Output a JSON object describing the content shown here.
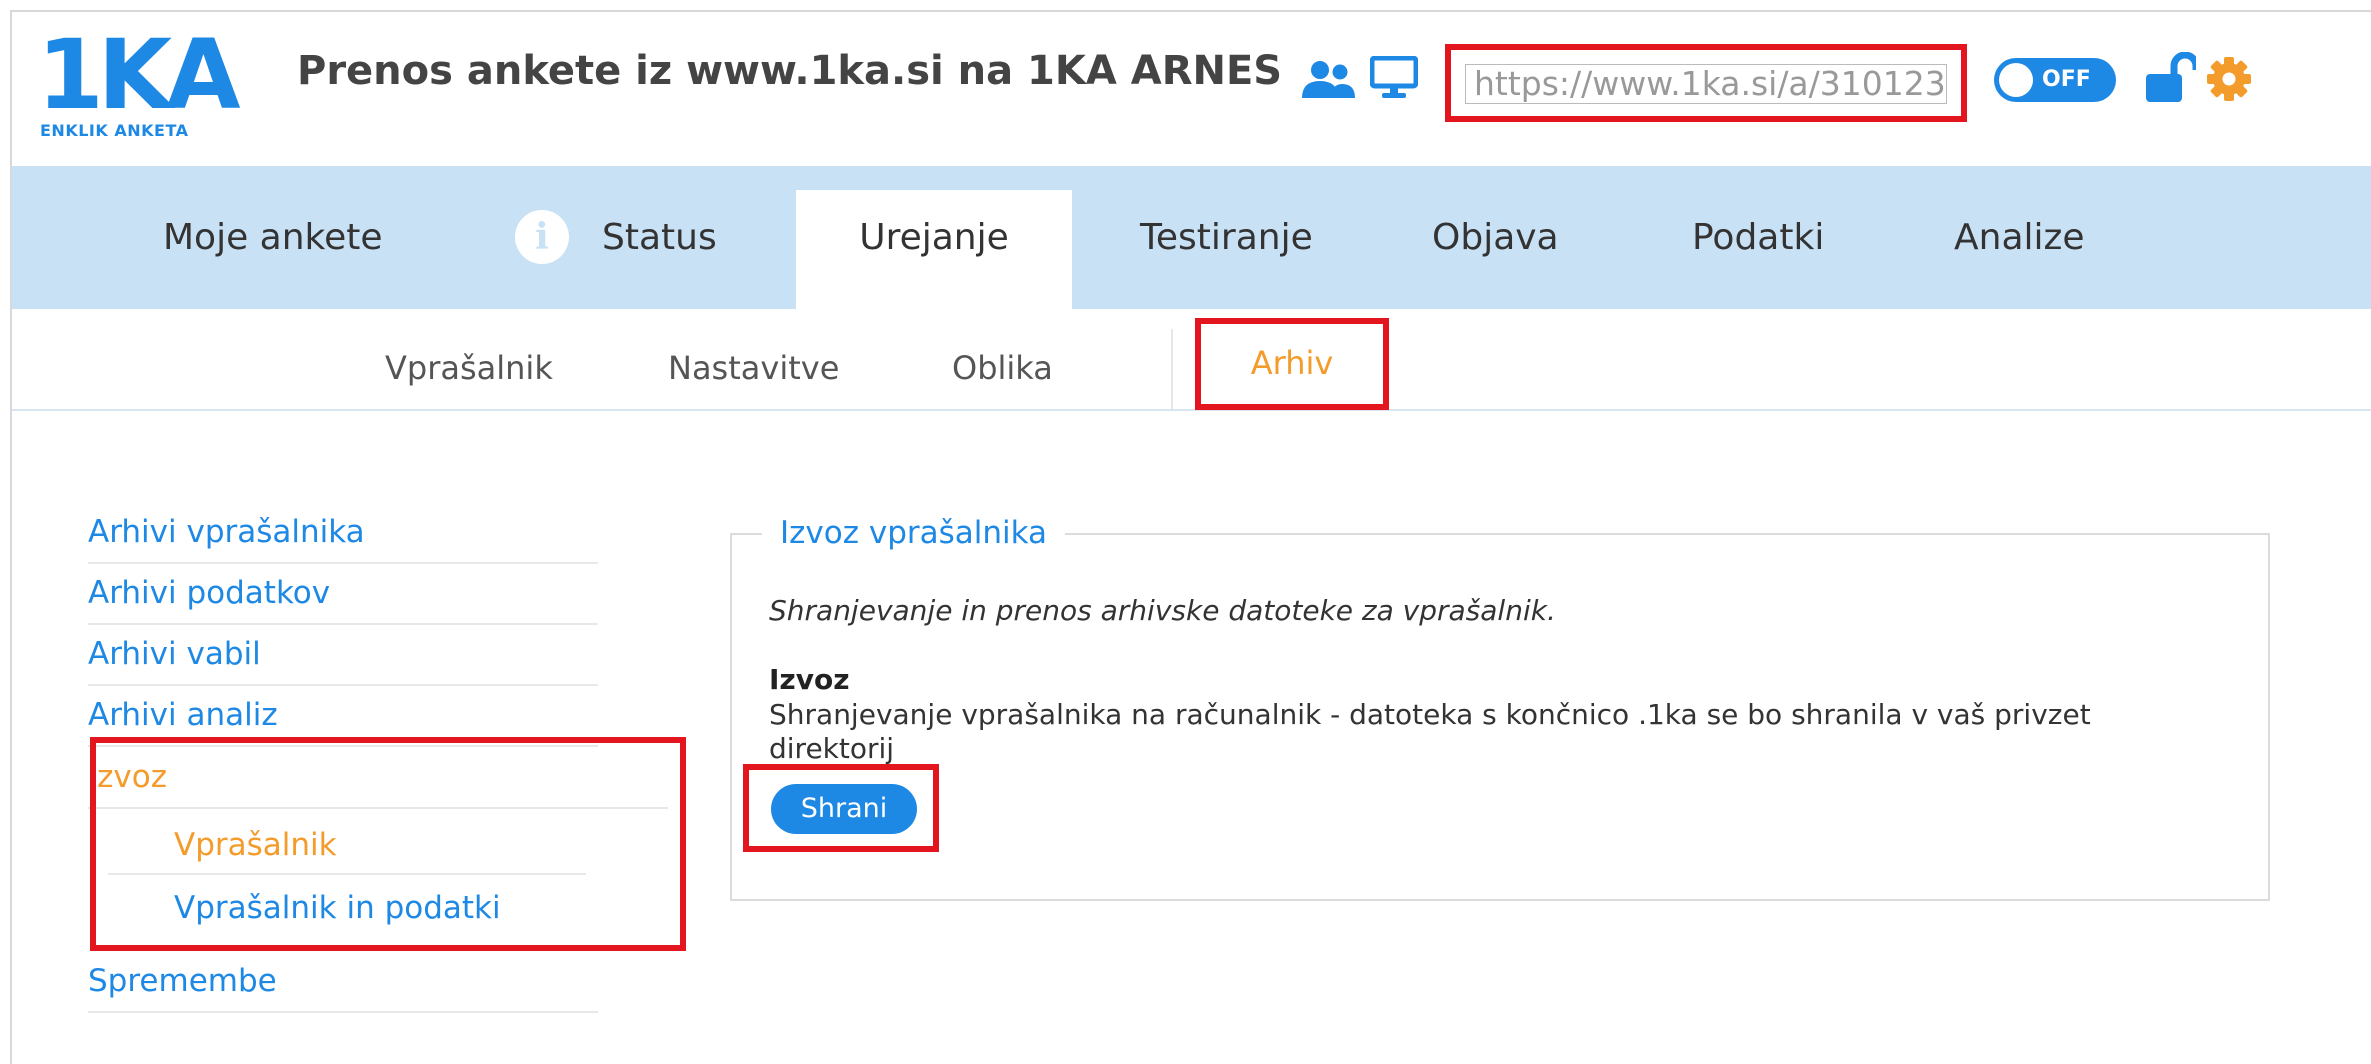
{
  "header": {
    "logo_text": "1KA",
    "logo_sub": "ENKLIK ANKETA",
    "title": "Prenos ankete iz www.1ka.si na 1KA ARNES",
    "url_value": "https://www.1ka.si/a/310123",
    "toggle_label": "OFF",
    "icons": [
      "users-icon",
      "monitor-icon",
      "unlock-icon",
      "gear-icon"
    ],
    "colors": {
      "accent": "#1e88e5",
      "orange": "#f39c2b",
      "highlight": "#e3151e",
      "tabs_bg": "#c9e1f5"
    }
  },
  "tabs": [
    {
      "label": "Moje ankete"
    },
    {
      "label": "Status"
    },
    {
      "label": "Urejanje"
    },
    {
      "label": "Testiranje"
    },
    {
      "label": "Objava"
    },
    {
      "label": "Podatki"
    },
    {
      "label": "Analize"
    }
  ],
  "subnav": [
    {
      "label": "Vprašalnik"
    },
    {
      "label": "Nastavitve"
    },
    {
      "label": "Oblika"
    },
    {
      "label": "Arhiv"
    }
  ],
  "sidebar": [
    {
      "label": "Arhivi vprašalnika"
    },
    {
      "label": "Arhivi podatkov"
    },
    {
      "label": "Arhivi vabil"
    },
    {
      "label": "Arhivi analiz"
    },
    {
      "label": "Izvoz"
    },
    {
      "label": "Vprašalnik"
    },
    {
      "label": "Vprašalnik in podatki"
    },
    {
      "label": "Spremembe"
    }
  ],
  "main": {
    "legend": "Izvoz vprašalnika",
    "description": "Shranjevanje in prenos arhivske datoteke za vprašalnik.",
    "izvoz_heading": "Izvoz",
    "izvoz_text": "Shranjevanje vprašalnika na računalnik - datoteka s končnico .1ka se bo shranila v vaš privzet direktorij",
    "save_button": "Shrani"
  }
}
